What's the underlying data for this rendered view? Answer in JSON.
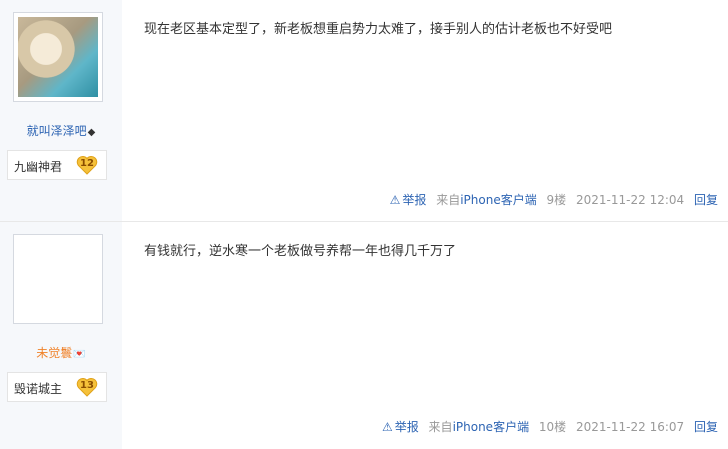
{
  "posts": [
    {
      "username": "就叫泽泽吧",
      "username_mark": "◆",
      "title": "九幽神君",
      "level": "12",
      "content": "现在老区基本定型了，新老板想重启势力太难了，接手别人的估计老板也不好受吧",
      "report": "举报",
      "source_prefix": "来自",
      "source": "iPhone客户端",
      "floor": "9楼",
      "time": "2021-11-22 12:04",
      "reply": "回复"
    },
    {
      "username": "未觉鬟",
      "username_mark": "💌",
      "title": "毁诺城主",
      "level": "13",
      "content": "有钱就行，逆水寒一个老板做号养帮一年也得几千万了",
      "report": "举报",
      "source_prefix": "来自",
      "source": "iPhone客户端",
      "floor": "10楼",
      "time": "2021-11-22 16:07",
      "reply": "回复"
    }
  ],
  "icons": {
    "report": "warning-triangle-icon",
    "level": "heart-badge-icon"
  },
  "colors": {
    "link": "#2d64b3",
    "badge": "#f5c13a"
  }
}
